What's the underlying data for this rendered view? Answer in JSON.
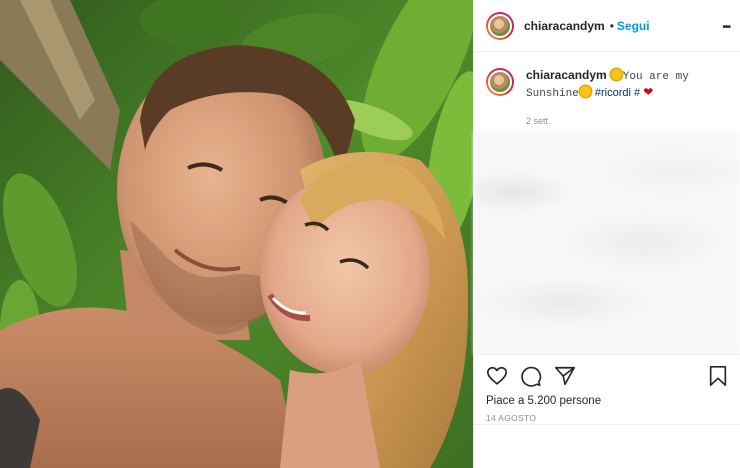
{
  "post": {
    "username": "chiaracandym",
    "follow_label": "Segui",
    "dot": "•",
    "more_label": "•••"
  },
  "caption": {
    "username": "chiaracandym",
    "text_part1": "You are my",
    "text_part2": "Sunshine",
    "hashtag": "#ricordi",
    "hash": "#",
    "time": "2 sett."
  },
  "engagement": {
    "likes_text": "Piace a 5.200 persone",
    "date_text": "14 AGOSTO"
  },
  "icons": {
    "like": "heart-icon",
    "comment": "comment-icon",
    "share": "share-icon",
    "save": "bookmark-icon"
  },
  "colors": {
    "follow": "#0095f6",
    "hashtag": "#00376b",
    "heart_emoji": "#d6001c"
  }
}
